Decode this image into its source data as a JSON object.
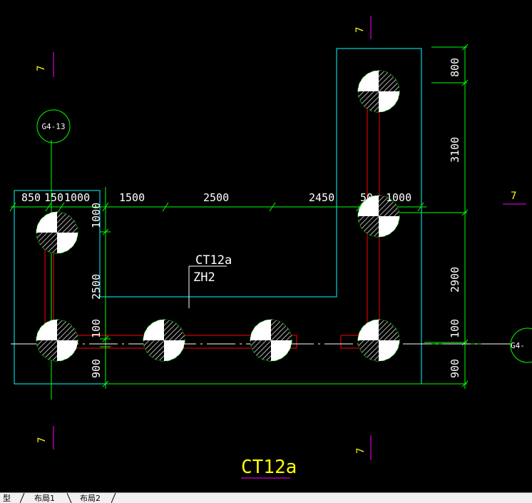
{
  "drawing": {
    "title": "CT12a",
    "cap_label": "CT12a",
    "cap_sublabel": "ZH2",
    "section_marks": [
      "7",
      "7",
      "7",
      "7",
      "7"
    ],
    "axis_labels": [
      "G4-13",
      "G4-"
    ],
    "top_dims": [
      "850",
      "150",
      "1000",
      "1500",
      "2500",
      "2450",
      "50",
      "1000"
    ],
    "right_dims": [
      "800",
      "3100",
      "2900",
      "100",
      "900"
    ],
    "left_dims": [
      "1000",
      "2500",
      "100",
      "900"
    ],
    "colors": {
      "background": "#000000",
      "outline": "#00ffff",
      "dimension": "#00ff00",
      "beam": "#ff0000",
      "pile": "#00ff00",
      "text": "#ffffff",
      "title": "#ffff00",
      "section_mark": "#ffff00",
      "section_line": "#ff00ff"
    }
  },
  "tabs": {
    "model": "型",
    "layout1": "布局1",
    "layout2": "布局2"
  }
}
